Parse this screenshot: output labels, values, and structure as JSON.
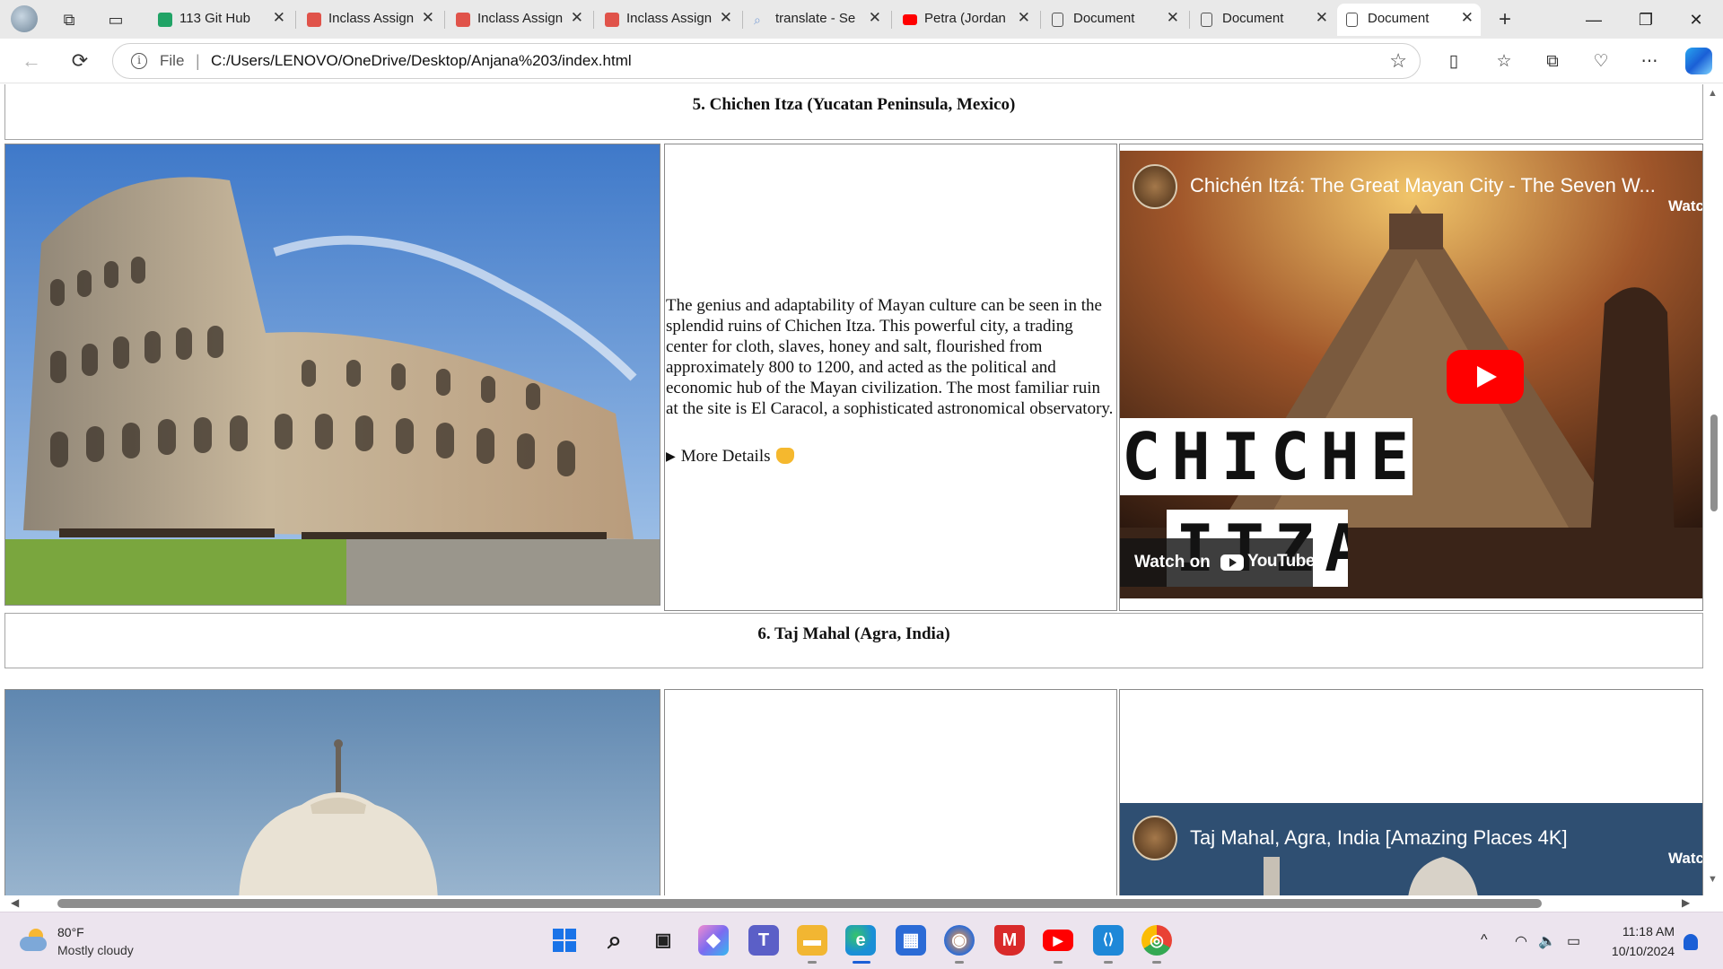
{
  "browser": {
    "tabs": [
      {
        "title": "113 Git Hub",
        "favicon_color": "#21a366",
        "active": false
      },
      {
        "title": "Inclass Assign",
        "favicon_color": "#e0534a",
        "active": false
      },
      {
        "title": "Inclass Assign",
        "favicon_color": "#e0534a",
        "active": false
      },
      {
        "title": "Inclass Assign",
        "favicon_color": "#e0534a",
        "active": false
      },
      {
        "title": "translate - Se",
        "favicon_color": "#7b9fd6",
        "active": false
      },
      {
        "title": "Petra (Jordan",
        "favicon_color": "#ff0000",
        "active": false
      },
      {
        "title": "Document",
        "favicon_color": "#ffffff",
        "active": false
      },
      {
        "title": "Document",
        "favicon_color": "#ffffff",
        "active": false
      },
      {
        "title": "Document",
        "favicon_color": "#ffffff",
        "active": true
      }
    ],
    "new_tab_glyph": "+",
    "close_glyph": "✕",
    "address": {
      "scheme_label": "File",
      "separator": "|",
      "url": "C:/Users/LENOVO/OneDrive/Desktop/Anjana%203/index.html"
    },
    "icons": {
      "back": "←",
      "reload": "⟳",
      "star": "☆",
      "split": "▯",
      "favorites": "☆",
      "collections": "⧉",
      "performance": "♡",
      "more": "⋯",
      "minimize": "—",
      "restore": "❐",
      "close": "✕"
    }
  },
  "page": {
    "section5": {
      "heading": "5. Chichen Itza (Yucatan Peninsula, Mexico)",
      "description": "The genius and adaptability of Mayan culture can be seen in the splendid ruins of Chichen Itza. This powerful city, a trading center for cloth, slaves, honey and salt, flourished from approximately 800 to 1200, and acted as the political and economic hub of the Mayan civilization. The most familiar ruin at the site is El Caracol, a sophisticated astronomical observatory.",
      "details_label": "More Details",
      "video": {
        "title": "Chichén Itzá: The Great Mayan City - The Seven W...",
        "watch_later": "Watc",
        "overlay_word_1": "CHICHEN",
        "overlay_word_2": "ITZA",
        "watch_on_label": "Watch on",
        "youtube_label": "YouTube"
      }
    },
    "section6": {
      "heading": "6. Taj Mahal (Agra, India)",
      "video": {
        "title": "Taj Mahal, Agra, India [Amazing Places 4K]",
        "watch_later": "Watc"
      }
    }
  },
  "scrollbars": {
    "up": "▲",
    "down": "▼",
    "left": "◀",
    "right": "▶"
  },
  "taskbar": {
    "weather": {
      "temp": "80°F",
      "condition": "Mostly cloudy"
    },
    "tray_icons": {
      "chevron": "^",
      "wifi": "◠",
      "volume": "🔈",
      "battery": "▭"
    },
    "clock": {
      "time": "11:18 AM",
      "date": "10/10/2024"
    },
    "apps": [
      {
        "name": "start",
        "color": "#1a73e8",
        "glyph": "⊞"
      },
      {
        "name": "search",
        "color": "transparent",
        "glyph": "⌕"
      },
      {
        "name": "task-view",
        "color": "transparent",
        "glyph": "▣"
      },
      {
        "name": "copilot",
        "color": "#b873ea",
        "glyph": "◆"
      },
      {
        "name": "teams",
        "color": "#5b5fc7",
        "glyph": "T"
      },
      {
        "name": "file-explorer",
        "color": "#f2b632",
        "glyph": "▬"
      },
      {
        "name": "edge",
        "color": "#1a8fd6",
        "glyph": "e"
      },
      {
        "name": "store",
        "color": "#2b6bd6",
        "glyph": "▦"
      },
      {
        "name": "firefox",
        "color": "#2b6bd6",
        "glyph": "◉"
      },
      {
        "name": "mcafee",
        "color": "#d92a2a",
        "glyph": "M"
      },
      {
        "name": "youtube",
        "color": "#ff0000",
        "glyph": "▶"
      },
      {
        "name": "vscode",
        "color": "#1e88d8",
        "glyph": "⟨⟩"
      },
      {
        "name": "chrome",
        "color": "#e94235",
        "glyph": "◎"
      }
    ]
  }
}
